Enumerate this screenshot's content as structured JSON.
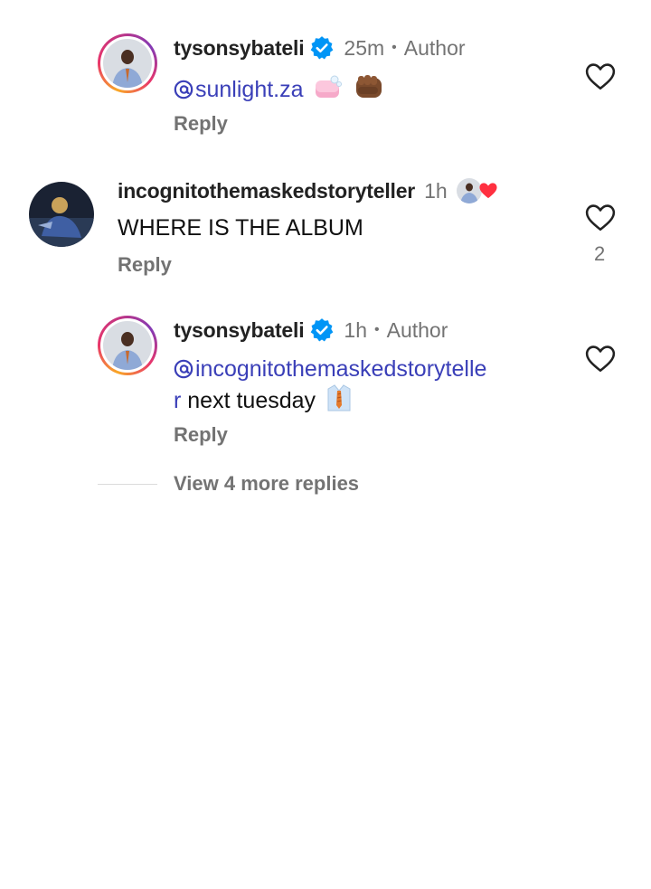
{
  "comments": [
    {
      "username": "tysonsybateli",
      "verified": true,
      "time": "25m",
      "author_tag": "Author",
      "mention": "sunlight.za",
      "text": "",
      "emoji": [
        "soap-emoji",
        "fist-emoji"
      ],
      "reply_label": "Reply",
      "like_count": ""
    },
    {
      "username": "incognitothemaskedstoryteller",
      "verified": false,
      "time": "1h",
      "text": "WHERE IS THE ALBUM",
      "liked_by_author": true,
      "reply_label": "Reply",
      "like_count": "2"
    },
    {
      "username": "tysonsybateli",
      "verified": true,
      "time": "1h",
      "author_tag": "Author",
      "mention_line1": "incognitothemaskedstorytelle",
      "mention_line2": "r",
      "text": " next tuesday",
      "emoji": [
        "shirt-tie-emoji"
      ],
      "reply_label": "Reply",
      "like_count": ""
    }
  ],
  "view_more": {
    "label": "View 4 more replies"
  },
  "colors": {
    "mention": "#3a3fb8",
    "muted": "#737373",
    "verified": "#0095f6",
    "heart_red": "#ff3040"
  }
}
